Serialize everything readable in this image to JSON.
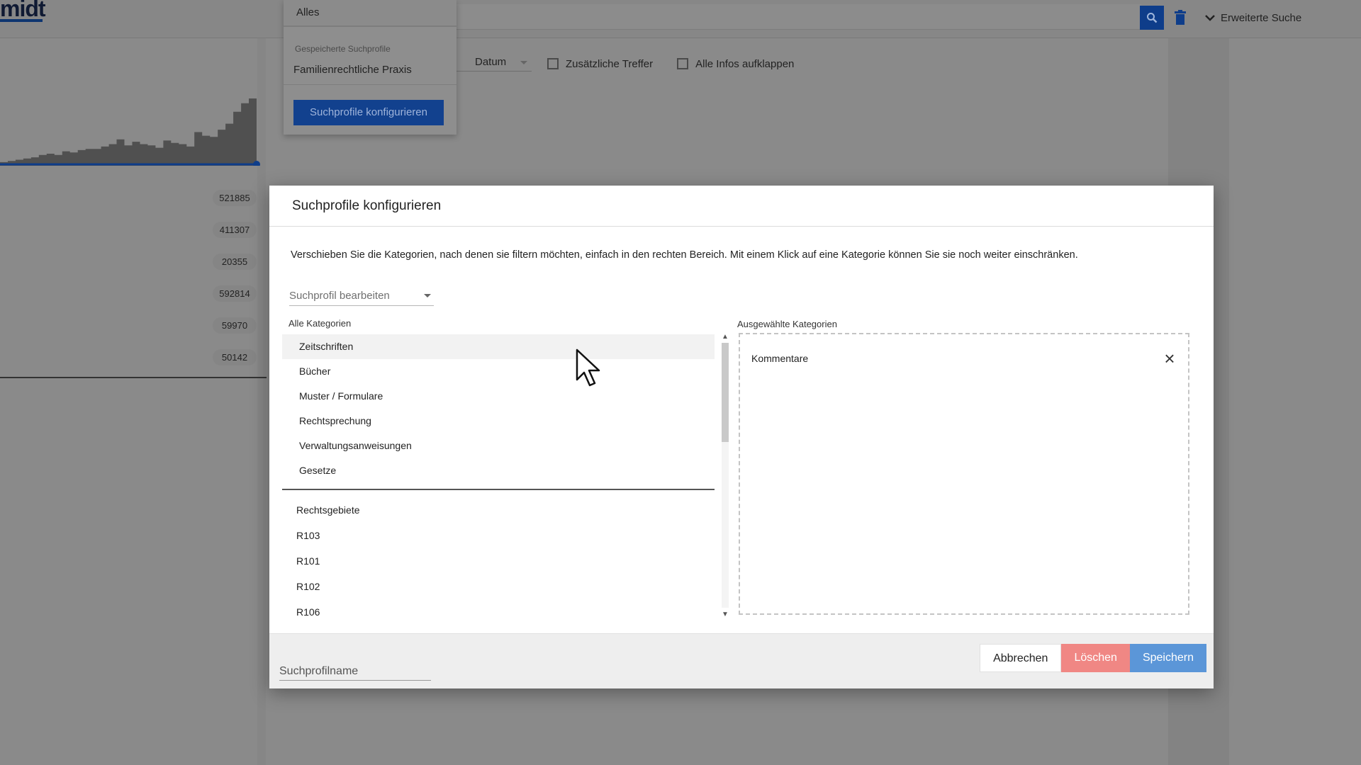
{
  "app": {
    "logo_text": "midt"
  },
  "header": {
    "search_icon": "search-icon",
    "trash_icon": "trash-icon",
    "advanced_search_label": "Erweiterte Suche"
  },
  "dropdown": {
    "selected": "Alles",
    "group_label": "Gespeicherte Suchprofile",
    "profiles": [
      "Familienrechtliche Praxis"
    ],
    "configure_button": "Suchprofile konfigurieren"
  },
  "filters": {
    "sort_select": "Datum",
    "additional_hits": "Zusätzliche Treffer",
    "expand_all": "Alle Infos aufklappen"
  },
  "sidebar": {
    "counts": [
      "521885",
      "411307",
      "20355",
      "592814",
      "59970",
      "50142"
    ],
    "histogram_values": [
      3,
      4,
      5,
      6,
      7,
      9,
      10,
      9,
      12,
      11,
      13,
      14,
      14,
      16,
      18,
      22,
      17,
      20,
      18,
      17,
      15,
      21,
      19,
      18,
      16,
      28,
      25,
      24,
      30,
      35,
      45,
      52,
      56
    ]
  },
  "modal": {
    "title": "Suchprofile konfigurieren",
    "description": "Verschieben Sie die Kategorien, nach denen sie filtern möchten, einfach in den rechten Bereich. Mit einem Klick auf eine Kategorie können Sie sie noch weiter einschränken.",
    "profile_select_placeholder": "Suchprofil bearbeiten",
    "all_categories_label": "Alle Kategorien",
    "categories": [
      "Zeitschriften",
      "Bücher",
      "Muster / Formulare",
      "Rechtsprechung",
      "Verwaltungsanweisungen",
      "Gesetze"
    ],
    "legal_areas_label": "Rechtsgebiete",
    "legal_areas": [
      "R103",
      "R101",
      "R102",
      "R106"
    ],
    "selected_categories_label": "Ausgewählte Kategorien",
    "selected_categories": [
      "Kommentare"
    ],
    "profile_name_placeholder": "Suchprofilname",
    "cancel_button": "Abbrechen",
    "delete_button": "Löschen",
    "save_button": "Speichern"
  },
  "colors": {
    "primary": "#0e3d8a",
    "delete": "#f08784",
    "save": "#5b96d8",
    "overlay": "#8a8a8a"
  }
}
